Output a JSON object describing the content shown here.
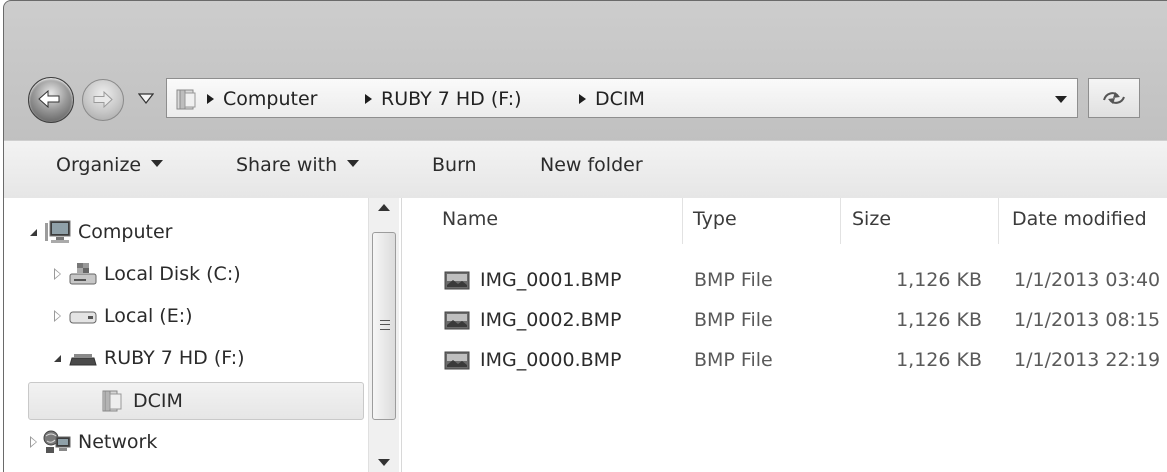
{
  "breadcrumb": [
    "Computer",
    "RUBY 7 HD (F:)",
    "DCIM"
  ],
  "toolbar": {
    "organize": "Organize",
    "share_with": "Share with",
    "burn": "Burn",
    "new_folder": "New folder"
  },
  "tree": [
    {
      "label": "Computer",
      "icon": "computer-icon",
      "expander": "expanded"
    },
    {
      "label": "Local Disk (C:)",
      "icon": "system-drive-icon",
      "expander": "collapsed"
    },
    {
      "label": "Local (E:)",
      "icon": "drive-icon",
      "expander": "collapsed"
    },
    {
      "label": "RUBY 7 HD (F:)",
      "icon": "removable-drive-icon",
      "expander": "expanded"
    },
    {
      "label": "DCIM",
      "icon": "folder-icon",
      "selected": true
    },
    {
      "label": "Network",
      "icon": "network-icon",
      "expander": "collapsed"
    }
  ],
  "columns": {
    "name": "Name",
    "type": "Type",
    "size": "Size",
    "date": "Date modified"
  },
  "files": [
    {
      "name": "IMG_0001.BMP",
      "type": "BMP File",
      "size": "1,126 KB",
      "date": "1/1/2013 03:40"
    },
    {
      "name": "IMG_0002.BMP",
      "type": "BMP File",
      "size": "1,126 KB",
      "date": "1/1/2013 08:15"
    },
    {
      "name": "IMG_0000.BMP",
      "type": "BMP File",
      "size": "1,126 KB",
      "date": "1/1/2013 22:19"
    }
  ]
}
